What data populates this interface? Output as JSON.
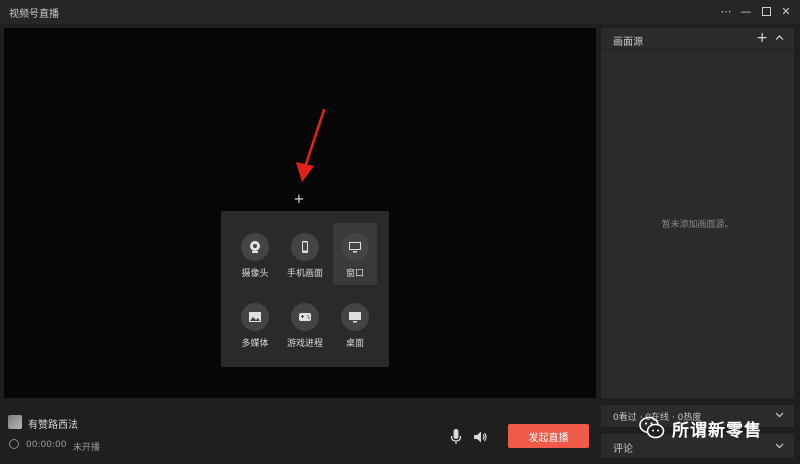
{
  "window": {
    "title": "视频号直播",
    "controls": [
      "more-icon",
      "minimize-icon",
      "maximize-icon",
      "close-icon"
    ]
  },
  "preview": {
    "add_symbol": "+",
    "source_menu": {
      "items": [
        {
          "label": "摄像头",
          "icon": "camera-icon"
        },
        {
          "label": "手机画面",
          "icon": "phone-icon"
        },
        {
          "label": "窗口",
          "icon": "window-icon",
          "active": true
        },
        {
          "label": "多媒体",
          "icon": "image-icon"
        },
        {
          "label": "游戏进程",
          "icon": "game-icon"
        },
        {
          "label": "桌面",
          "icon": "desktop-icon"
        }
      ]
    }
  },
  "source_panel": {
    "title": "画面源",
    "empty_text": "暂未添加画面源。"
  },
  "stats": {
    "text": "0看过 · 0在线 · 0热度"
  },
  "comments": {
    "label": "评论"
  },
  "user": {
    "name": "有赞路西法"
  },
  "status": {
    "timer": "00:00:00",
    "live_state": "未开播"
  },
  "actions": {
    "go_live_label": "发起直播"
  },
  "watermark": {
    "text": "所谓新零售"
  },
  "colors": {
    "accent": "#f05a4a",
    "arrow": "#e2231a",
    "background": "#1f1f1f",
    "panel": "#2b2b2b",
    "preview": "#060606"
  }
}
